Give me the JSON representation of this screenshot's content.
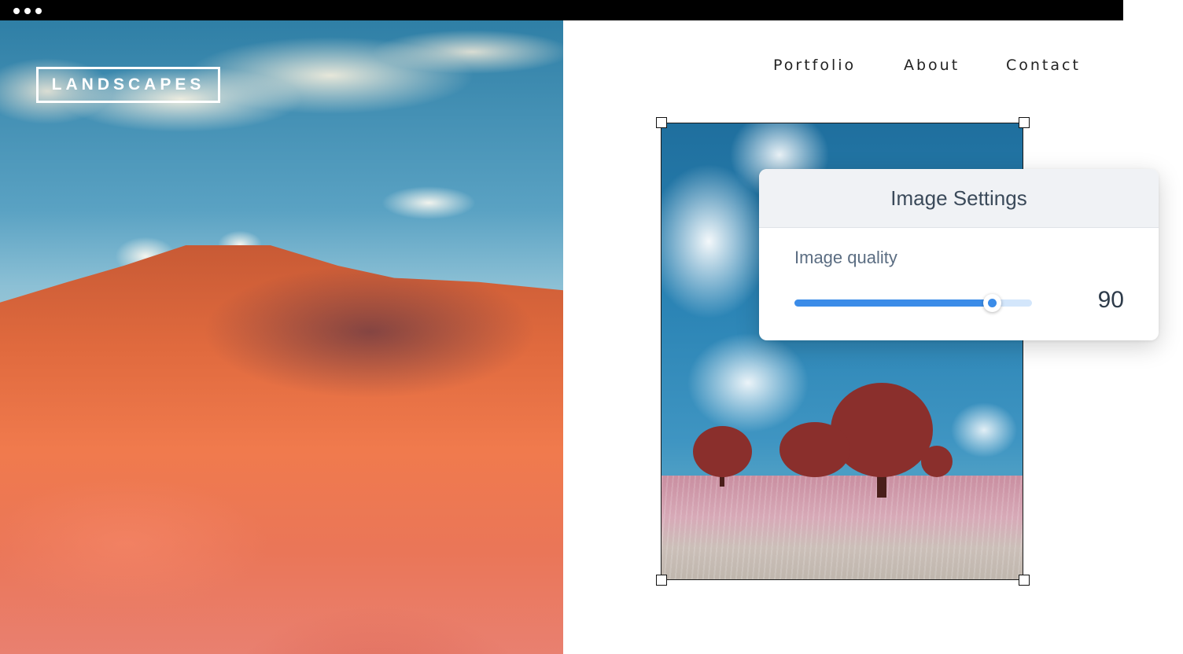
{
  "site": {
    "logo": "LANDSCAPES",
    "nav": [
      "Portfolio",
      "About",
      "Contact"
    ]
  },
  "image_settings": {
    "title": "Image Settings",
    "quality_label": "Image quality",
    "quality_value": "90",
    "quality_fraction": 0.83
  },
  "colors": {
    "accent": "#3b8ce8",
    "track": "#d3e6fb"
  }
}
